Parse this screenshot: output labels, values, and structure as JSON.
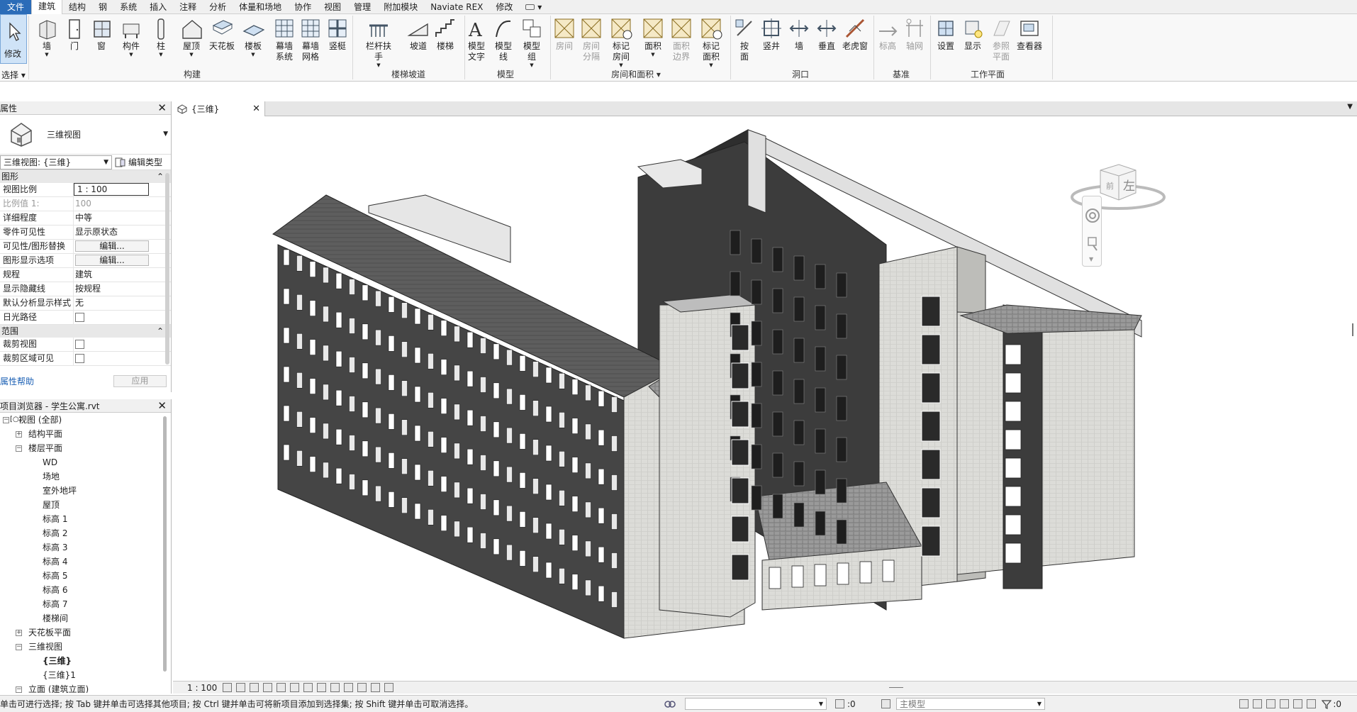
{
  "menu": {
    "items": [
      "文件",
      "建筑",
      "结构",
      "钢",
      "系统",
      "插入",
      "注释",
      "分析",
      "体量和场地",
      "协作",
      "视图",
      "管理",
      "附加模块",
      "Naviate REX",
      "修改"
    ],
    "active": "建筑"
  },
  "ribbon": {
    "select_label": "选择",
    "buttons": {
      "modify": "修改",
      "wall": "墙",
      "door": "门",
      "window": "窗",
      "component": "构件",
      "column": "柱",
      "roof": "屋顶",
      "ceiling": "天花板",
      "floor": "楼板",
      "curtain_system_1": "幕墙",
      "curtain_system_2": "系统",
      "curtain_grid_1": "幕墙",
      "curtain_grid_2": "网格",
      "mullion": "竖梃",
      "railing": "栏杆扶手",
      "ramp": "坡道",
      "stair": "楼梯",
      "model_text_1": "模型",
      "model_text_2": "文字",
      "model_line_1": "模型",
      "model_line_2": "线",
      "model_group_1": "模型",
      "model_group_2": "组",
      "room": "房间",
      "room_sep_1": "房间",
      "room_sep_2": "分隔",
      "tag_room_1": "标记",
      "tag_room_2": "房间",
      "area": "面积",
      "area_boundary_1": "面积",
      "area_boundary_2": "边界",
      "tag_area_1": "标记",
      "tag_area_2": "面积",
      "by_face_1": "按",
      "by_face_2": "面",
      "shaft": "竖井",
      "wall_opening": "墙",
      "vertical": "垂直",
      "dormer": "老虎窗",
      "level": "标高",
      "grid": "轴网",
      "set": "设置",
      "show": "显示",
      "ref_plane_1": "参照",
      "ref_plane_2": "平面",
      "viewer": "查看器"
    },
    "panels": {
      "build": "构建",
      "circulation": "楼梯坡道",
      "model": "模型",
      "room_area": "房间和面积",
      "opening": "洞口",
      "datum": "基准",
      "work_plane": "工作平面"
    }
  },
  "properties": {
    "title": "属性",
    "type_name": "三维视图",
    "selector": "三维视图: {三维}",
    "edit_type": "编辑类型",
    "section_graphics": "图形",
    "rows": [
      {
        "k": "视图比例",
        "v": "1 : 100"
      },
      {
        "k": "比例值 1:",
        "v": "100"
      },
      {
        "k": "详细程度",
        "v": "中等"
      },
      {
        "k": "零件可见性",
        "v": "显示原状态"
      },
      {
        "k": "可见性/图形替换",
        "v": "编辑..."
      },
      {
        "k": "图形显示选项",
        "v": "编辑..."
      },
      {
        "k": "规程",
        "v": "建筑"
      },
      {
        "k": "显示隐藏线",
        "v": "按规程"
      },
      {
        "k": "默认分析显示样式",
        "v": "无"
      },
      {
        "k": "日光路径",
        "v": ""
      }
    ],
    "section_extents": "范围",
    "rows2": [
      {
        "k": "裁剪视图",
        "v": ""
      },
      {
        "k": "裁剪区域可见",
        "v": ""
      }
    ],
    "help": "属性帮助",
    "apply": "应用"
  },
  "browser": {
    "title": "项目浏览器 - 学生公寓.rvt",
    "items": [
      {
        "label": "视图 (全部)",
        "level": 0,
        "toggle": "-"
      },
      {
        "label": "结构平面",
        "level": 1,
        "toggle": "+"
      },
      {
        "label": "楼层平面",
        "level": 1,
        "toggle": "-"
      },
      {
        "label": "WD",
        "level": 2
      },
      {
        "label": "场地",
        "level": 2
      },
      {
        "label": "室外地坪",
        "level": 2
      },
      {
        "label": "屋顶",
        "level": 2
      },
      {
        "label": "标高 1",
        "level": 2
      },
      {
        "label": "标高 2",
        "level": 2
      },
      {
        "label": "标高 3",
        "level": 2
      },
      {
        "label": "标高 4",
        "level": 2
      },
      {
        "label": "标高 5",
        "level": 2
      },
      {
        "label": "标高 6",
        "level": 2
      },
      {
        "label": "标高 7",
        "level": 2
      },
      {
        "label": "楼梯间",
        "level": 2
      },
      {
        "label": "天花板平面",
        "level": 1,
        "toggle": "+"
      },
      {
        "label": "三维视图",
        "level": 1,
        "toggle": "-"
      },
      {
        "label": "{三维}",
        "level": 2,
        "bold": true
      },
      {
        "label": "{三维}1",
        "level": 2
      },
      {
        "label": "立面 (建筑立面)",
        "level": 1,
        "toggle": "-"
      }
    ]
  },
  "view": {
    "tab_label": "{三维}",
    "scale": "1 : 100",
    "viewcube_face": "左"
  },
  "status": {
    "message": "单击可进行选择; 按 Tab 键并单击可选择其他项目; 按 Ctrl 键并单击可将新项目添加到选择集; 按 Shift 键并单击可取消选择。",
    "count": ":0",
    "model": "主模型",
    "filter_count": ":0"
  },
  "colors": {
    "accent": "#2b6cb8",
    "roof": "#5a5a5a",
    "wall": "#d6d6d2",
    "dark_face": "#3a3a3a"
  }
}
